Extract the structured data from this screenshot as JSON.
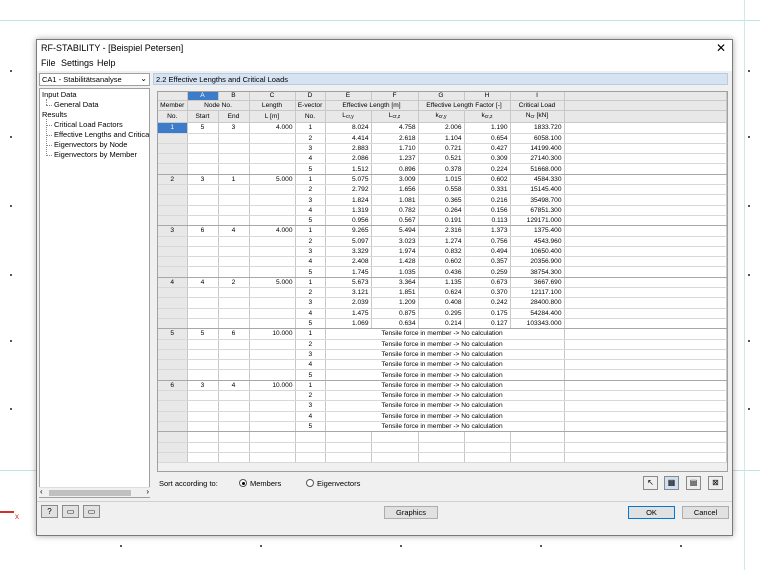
{
  "window": {
    "title": "RF-STABILITY - [Beispiel Petersen]",
    "close_glyph": "✕"
  },
  "menu": [
    "File",
    "Settings",
    "Help"
  ],
  "navigator": {
    "case": "CA1 - Stabilitätsanalyse",
    "tree": {
      "input_data": "Input Data",
      "general_data": "General Data",
      "results": "Results",
      "critical_load_factors": "Critical Load Factors",
      "effective_lengths": "Effective Lengths and Critical L",
      "eigenvectors_by_node": "Eigenvectors by Node",
      "eigenvectors_by_member": "Eigenvectors by Member"
    }
  },
  "section_title": "2.2 Effective Lengths and Critical Loads",
  "table": {
    "letters": [
      "A",
      "B",
      "C",
      "D",
      "E",
      "F",
      "G",
      "H",
      "I"
    ],
    "headers": {
      "member": "Member",
      "member_no": "No.",
      "node_no": "Node No.",
      "start": "Start",
      "end": "End",
      "length": "Length",
      "length_unit": "L [m]",
      "evector": "E-vector",
      "evector_no": "No.",
      "eff_length": "Effective Length [m]",
      "lcry": "Lcr,y",
      "lcrz": "Lcr,z",
      "eff_factor": "Effective Length Factor [-]",
      "kcry": "kcr,y",
      "kcrz": "kcr,z",
      "crit_load": "Critical Load",
      "ncr": "Ncr [kN]"
    },
    "members": [
      {
        "no": "1",
        "start": "5",
        "end": "3",
        "length": "4.000",
        "rows": [
          [
            "1",
            "8.024",
            "4.758",
            "2.006",
            "1.190",
            "1833.720"
          ],
          [
            "2",
            "4.414",
            "2.618",
            "1.104",
            "0.654",
            "6058.100"
          ],
          [
            "3",
            "2.883",
            "1.710",
            "0.721",
            "0.427",
            "14199.400"
          ],
          [
            "4",
            "2.086",
            "1.237",
            "0.521",
            "0.309",
            "27140.300"
          ],
          [
            "5",
            "1.512",
            "0.896",
            "0.378",
            "0.224",
            "51668.000"
          ]
        ]
      },
      {
        "no": "2",
        "start": "3",
        "end": "1",
        "length": "5.000",
        "rows": [
          [
            "1",
            "5.075",
            "3.009",
            "1.015",
            "0.602",
            "4584.330"
          ],
          [
            "2",
            "2.792",
            "1.656",
            "0.558",
            "0.331",
            "15145.400"
          ],
          [
            "3",
            "1.824",
            "1.081",
            "0.365",
            "0.216",
            "35498.700"
          ],
          [
            "4",
            "1.319",
            "0.782",
            "0.264",
            "0.156",
            "67851.300"
          ],
          [
            "5",
            "0.956",
            "0.567",
            "0.191",
            "0.113",
            "129171.000"
          ]
        ]
      },
      {
        "no": "3",
        "start": "6",
        "end": "4",
        "length": "4.000",
        "rows": [
          [
            "1",
            "9.265",
            "5.494",
            "2.316",
            "1.373",
            "1375.400"
          ],
          [
            "2",
            "5.097",
            "3.023",
            "1.274",
            "0.756",
            "4543.960"
          ],
          [
            "3",
            "3.329",
            "1.974",
            "0.832",
            "0.494",
            "10650.400"
          ],
          [
            "4",
            "2.408",
            "1.428",
            "0.602",
            "0.357",
            "20356.900"
          ],
          [
            "5",
            "1.745",
            "1.035",
            "0.436",
            "0.259",
            "38754.300"
          ]
        ]
      },
      {
        "no": "4",
        "start": "4",
        "end": "2",
        "length": "5.000",
        "rows": [
          [
            "1",
            "5.673",
            "3.364",
            "1.135",
            "0.673",
            "3667.690"
          ],
          [
            "2",
            "3.121",
            "1.851",
            "0.624",
            "0.370",
            "12117.100"
          ],
          [
            "3",
            "2.039",
            "1.209",
            "0.408",
            "0.242",
            "28400.800"
          ],
          [
            "4",
            "1.475",
            "0.875",
            "0.295",
            "0.175",
            "54284.400"
          ],
          [
            "5",
            "1.069",
            "0.634",
            "0.214",
            "0.127",
            "103343.000"
          ]
        ]
      },
      {
        "no": "5",
        "start": "5",
        "end": "6",
        "length": "10.000",
        "message": "Tensile force in member -> No calculation",
        "vectors": [
          "1",
          "2",
          "3",
          "4",
          "5"
        ]
      },
      {
        "no": "6",
        "start": "3",
        "end": "4",
        "length": "10.000",
        "message": "Tensile force in member -> No calculation",
        "vectors": [
          "1",
          "2",
          "3",
          "4",
          "5"
        ]
      }
    ]
  },
  "sort": {
    "label": "Sort according to:",
    "options": [
      "Members",
      "Eigenvectors"
    ],
    "selected": "Members"
  },
  "buttons": {
    "graphics": "Graphics",
    "ok": "OK",
    "cancel": "Cancel"
  },
  "canvas": {
    "axis_label": "x"
  },
  "colors": {
    "selection": "#3d7cc9",
    "section_header": "#d6e3f2",
    "axis": "#d23030"
  }
}
